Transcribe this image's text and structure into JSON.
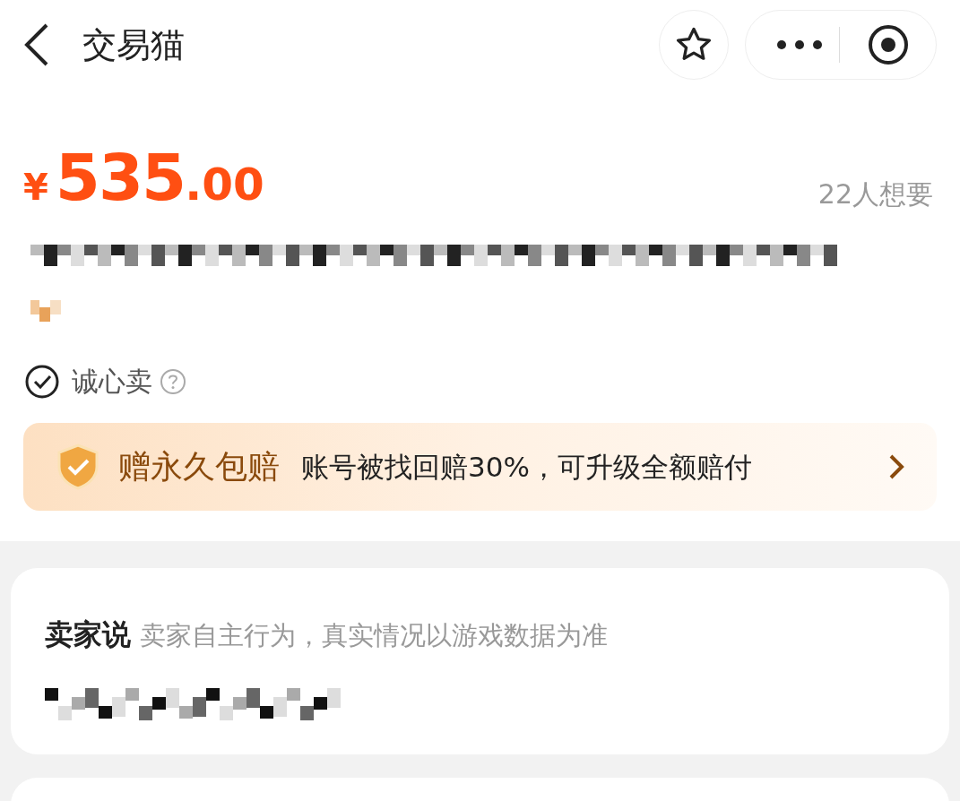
{
  "header": {
    "title": "交易猫"
  },
  "price": {
    "currency": "¥",
    "integer": "535",
    "decimal": ".00",
    "wants": "22人想要"
  },
  "tags": [
    {
      "label": "诚心卖"
    }
  ],
  "guarantee": {
    "title": "赠永久包赔",
    "text": "账号被找回赔30%，可升级全额赔付"
  },
  "seller_note": {
    "title": "卖家说",
    "subtitle": "卖家自主行为，真实情况以游戏数据为准"
  }
}
